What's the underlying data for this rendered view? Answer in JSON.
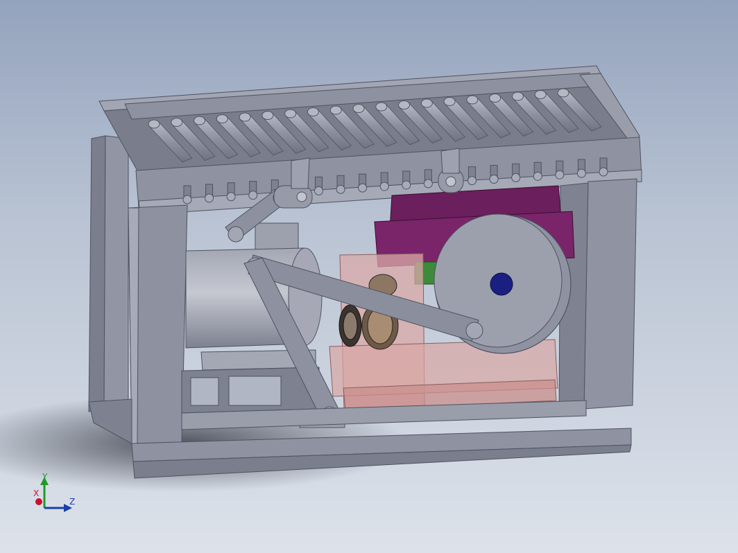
{
  "viewport": {
    "background_top": "#94a3bd",
    "background_bottom": "#dde2ea"
  },
  "model": {
    "frame_color": "#8a8e9c",
    "frame_dark": "#6c7080",
    "roller_color": "#9094a2",
    "gearbox_color": "#6b1f5c",
    "transparent_housing_color": "#d9aaa8",
    "link_color": "#878b99",
    "hub_color": "#1b1f82",
    "roller_count_top": 19,
    "roller_count_lower": 20
  },
  "triad": {
    "x_label": "X",
    "y_label": "Y",
    "z_label": "Z",
    "x_color": "#c8102e",
    "y_color": "#1f9a2a",
    "z_color": "#1b3fa8"
  }
}
